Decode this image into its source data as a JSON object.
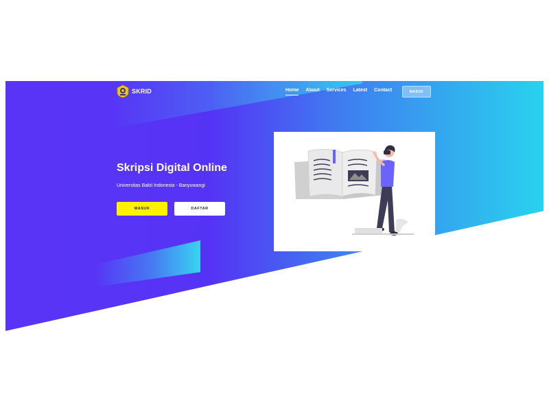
{
  "brand": {
    "name": "SKRID",
    "emblem_icon": "university-emblem-icon"
  },
  "nav": {
    "items": [
      {
        "label": "Home",
        "active": true
      },
      {
        "label": "About",
        "active": false
      },
      {
        "label": "Services",
        "active": false
      },
      {
        "label": "Latest",
        "active": false
      },
      {
        "label": "Contact",
        "active": false
      }
    ],
    "login_button": "MASUK"
  },
  "hero": {
    "title": "Skripsi Digital Online",
    "subtitle": "Universitas Bakti Indonesia - Banyuwangi",
    "primary_button": "MASUK",
    "secondary_button": "DAFTAR",
    "illustration_icon": "reading-book-illustration"
  },
  "colors": {
    "gradient_start": "#5a34f6",
    "gradient_end": "#29d2ee",
    "accent_yellow": "#fff200",
    "nav_button": "#7ec0f8",
    "illustration_purple": "#6c63ff"
  }
}
